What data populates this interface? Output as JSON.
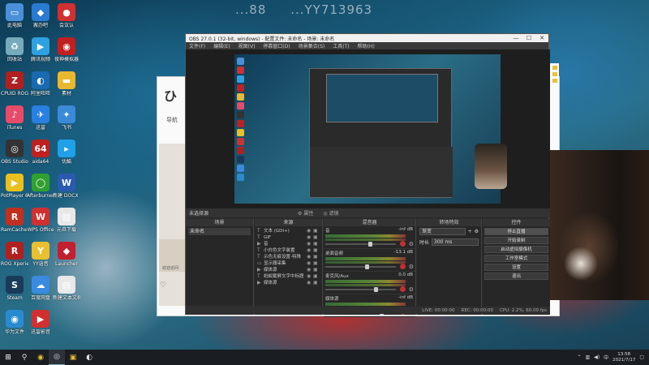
{
  "watermark": {
    "parts": [
      "...88",
      "...YY713963"
    ]
  },
  "desktop_icons": [
    {
      "label": "此电脑",
      "color": "#4a8fd8",
      "glyph": "▭"
    },
    {
      "label": "搬办吧",
      "color": "#2a7ad0",
      "glyph": "◆"
    },
    {
      "label": "会议认",
      "color": "#d03030",
      "glyph": "●"
    },
    {
      "label": "回收站",
      "color": "#7ab",
      "glyph": "♻"
    },
    {
      "label": "腾讯视频",
      "color": "#30a0e0",
      "glyph": "▶"
    },
    {
      "label": "夜神模拟器",
      "color": "#c02020",
      "glyph": "◉"
    },
    {
      "label": "CPUID ROG CPU-Z",
      "color": "#b02020",
      "glyph": "Z"
    },
    {
      "label": "阿里旺旺",
      "color": "#1a6ab0",
      "glyph": "◐"
    },
    {
      "label": "素材",
      "color": "#e8b830",
      "glyph": "▬"
    },
    {
      "label": "iTunes",
      "color": "#e84a6a",
      "glyph": "♪"
    },
    {
      "label": "迅雷",
      "color": "#2a80e0",
      "glyph": "✈"
    },
    {
      "label": "飞书",
      "color": "#3a8ad8",
      "glyph": "✦"
    },
    {
      "label": "OBS Studio",
      "color": "#333",
      "glyph": "◎"
    },
    {
      "label": "aida64",
      "color": "#c02020",
      "glyph": "64"
    },
    {
      "label": "优酷",
      "color": "#20a0e8",
      "glyph": "▸"
    },
    {
      "label": "PotPlayer 64 bit",
      "color": "#e8c020",
      "glyph": "▶"
    },
    {
      "label": "Afterburner",
      "color": "#30a030",
      "glyph": "◯"
    },
    {
      "label": "新建 DOCX 文档",
      "color": "#2a5ab0",
      "glyph": "W"
    },
    {
      "label": "RamCache III",
      "color": "#c03020",
      "glyph": "R"
    },
    {
      "label": "WPS Office",
      "color": "#d03030",
      "glyph": "W"
    },
    {
      "label": "元旦下载",
      "color": "#e8e8e8",
      "glyph": "▤"
    },
    {
      "label": "ROG Xperience",
      "color": "#b02020",
      "glyph": "R"
    },
    {
      "label": "YY语音",
      "color": "#e8c030",
      "glyph": "Y"
    },
    {
      "label": "Launcher",
      "color": "#c02030",
      "glyph": "◆"
    },
    {
      "label": "Steam",
      "color": "#1a3a5a",
      "glyph": "S"
    },
    {
      "label": "百度网盘",
      "color": "#3a8ae0",
      "glyph": "☁"
    },
    {
      "label": "新建文本文档",
      "color": "#e8e8e8",
      "glyph": "▤"
    },
    {
      "label": "华为文件",
      "color": "#2a8ad0",
      "glyph": "◉"
    },
    {
      "label": "迅雷影音",
      "color": "#d03030",
      "glyph": "▶"
    }
  ],
  "browser": {
    "tab": "导航",
    "caption": "欢迎访问",
    "logo": "ひ"
  },
  "obs": {
    "title": "OBS 27.0.1 (32-bit, windows) - 配置文件: 未命名 - 场景: 未命名",
    "menu": [
      "文件(F)",
      "编辑(E)",
      "视图(V)",
      "停靠窗口(D)",
      "场景集合(S)",
      "工具(T)",
      "帮助(H)"
    ],
    "scene_bar": {
      "label": "未选择源",
      "props": "属性",
      "filters": "滤镜"
    },
    "docks": {
      "scenes": {
        "title": "场景",
        "items": [
          "未命名"
        ]
      },
      "sources": {
        "title": "来源",
        "items": [
          {
            "name": "文本 (GDI+)",
            "icon": "T"
          },
          {
            "name": "GIF",
            "icon": "T"
          },
          {
            "name": "音",
            "icon": "▶"
          },
          {
            "name": "小白色文字装置",
            "icon": "T"
          },
          {
            "name": "示色无痕设置-特殊",
            "icon": "T"
          },
          {
            "name": "显示器采集",
            "icon": "▭"
          },
          {
            "name": "媒体源",
            "icon": "▶"
          },
          {
            "name": "蚂蚁截屏文字中标题",
            "icon": "T"
          },
          {
            "name": "媒体源",
            "icon": "▶"
          }
        ]
      },
      "mixer": {
        "title": "混音器",
        "channels": [
          {
            "name": "音",
            "db": "-inf dB",
            "level": 0.62
          },
          {
            "name": "桌面音频",
            "db": "-13.1 dB",
            "level": 0.58
          },
          {
            "name": "麦克风/Aux",
            "db": "0.0 dB",
            "level": 0.7
          },
          {
            "name": "媒体源",
            "db": "-inf dB",
            "level": 0.78
          }
        ]
      },
      "transitions": {
        "title": "转场特效",
        "type": "渐变",
        "duration_label": "时长",
        "duration": "300 ms"
      },
      "controls": {
        "title": "控件",
        "buttons": [
          "停止直播",
          "开始录制",
          "启动虚拟摄像机",
          "工作室模式",
          "设置",
          "退出"
        ]
      }
    },
    "status": {
      "live": "LIVE: 00:00:00",
      "rec": "REC: 00:00:00",
      "cpu": "CPU: 2.2%, 60.00 fps"
    }
  },
  "taskbar": {
    "time": "13:58",
    "date": "2021/7/17"
  }
}
